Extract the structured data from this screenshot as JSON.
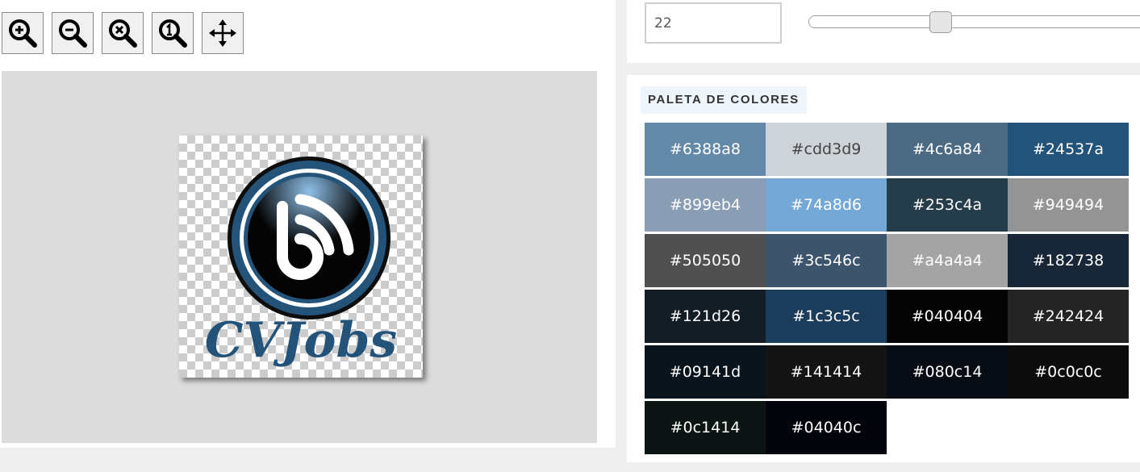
{
  "toolbar": {
    "buttons": [
      {
        "name": "zoom-in-button",
        "icon": "zoom-in-icon"
      },
      {
        "name": "zoom-out-button",
        "icon": "zoom-out-icon"
      },
      {
        "name": "zoom-reset-button",
        "icon": "zoom-cancel-icon"
      },
      {
        "name": "zoom-actual-size-button",
        "icon": "zoom-one-icon"
      },
      {
        "name": "move-button",
        "icon": "move-arrows-icon"
      }
    ]
  },
  "preview": {
    "logo_text": "CVJobs",
    "colors": {
      "ring": "#24537a",
      "text": "#24537a",
      "disc": "#040404"
    }
  },
  "size": {
    "value": "22",
    "slider_fraction": 0.4
  },
  "palette": {
    "heading": "PALETA DE COLORES",
    "swatches": [
      {
        "hex": "#6388a8"
      },
      {
        "hex": "#cdd3d9"
      },
      {
        "hex": "#4c6a84"
      },
      {
        "hex": "#24537a"
      },
      {
        "hex": "#899eb4"
      },
      {
        "hex": "#74a8d6"
      },
      {
        "hex": "#253c4a"
      },
      {
        "hex": "#949494"
      },
      {
        "hex": "#505050"
      },
      {
        "hex": "#3c546c"
      },
      {
        "hex": "#a4a4a4"
      },
      {
        "hex": "#182738"
      },
      {
        "hex": "#121d26"
      },
      {
        "hex": "#1c3c5c"
      },
      {
        "hex": "#040404"
      },
      {
        "hex": "#242424"
      },
      {
        "hex": "#09141d"
      },
      {
        "hex": "#141414"
      },
      {
        "hex": "#080c14"
      },
      {
        "hex": "#0c0c0c"
      },
      {
        "hex": "#0c1414"
      },
      {
        "hex": "#04040c"
      }
    ]
  }
}
